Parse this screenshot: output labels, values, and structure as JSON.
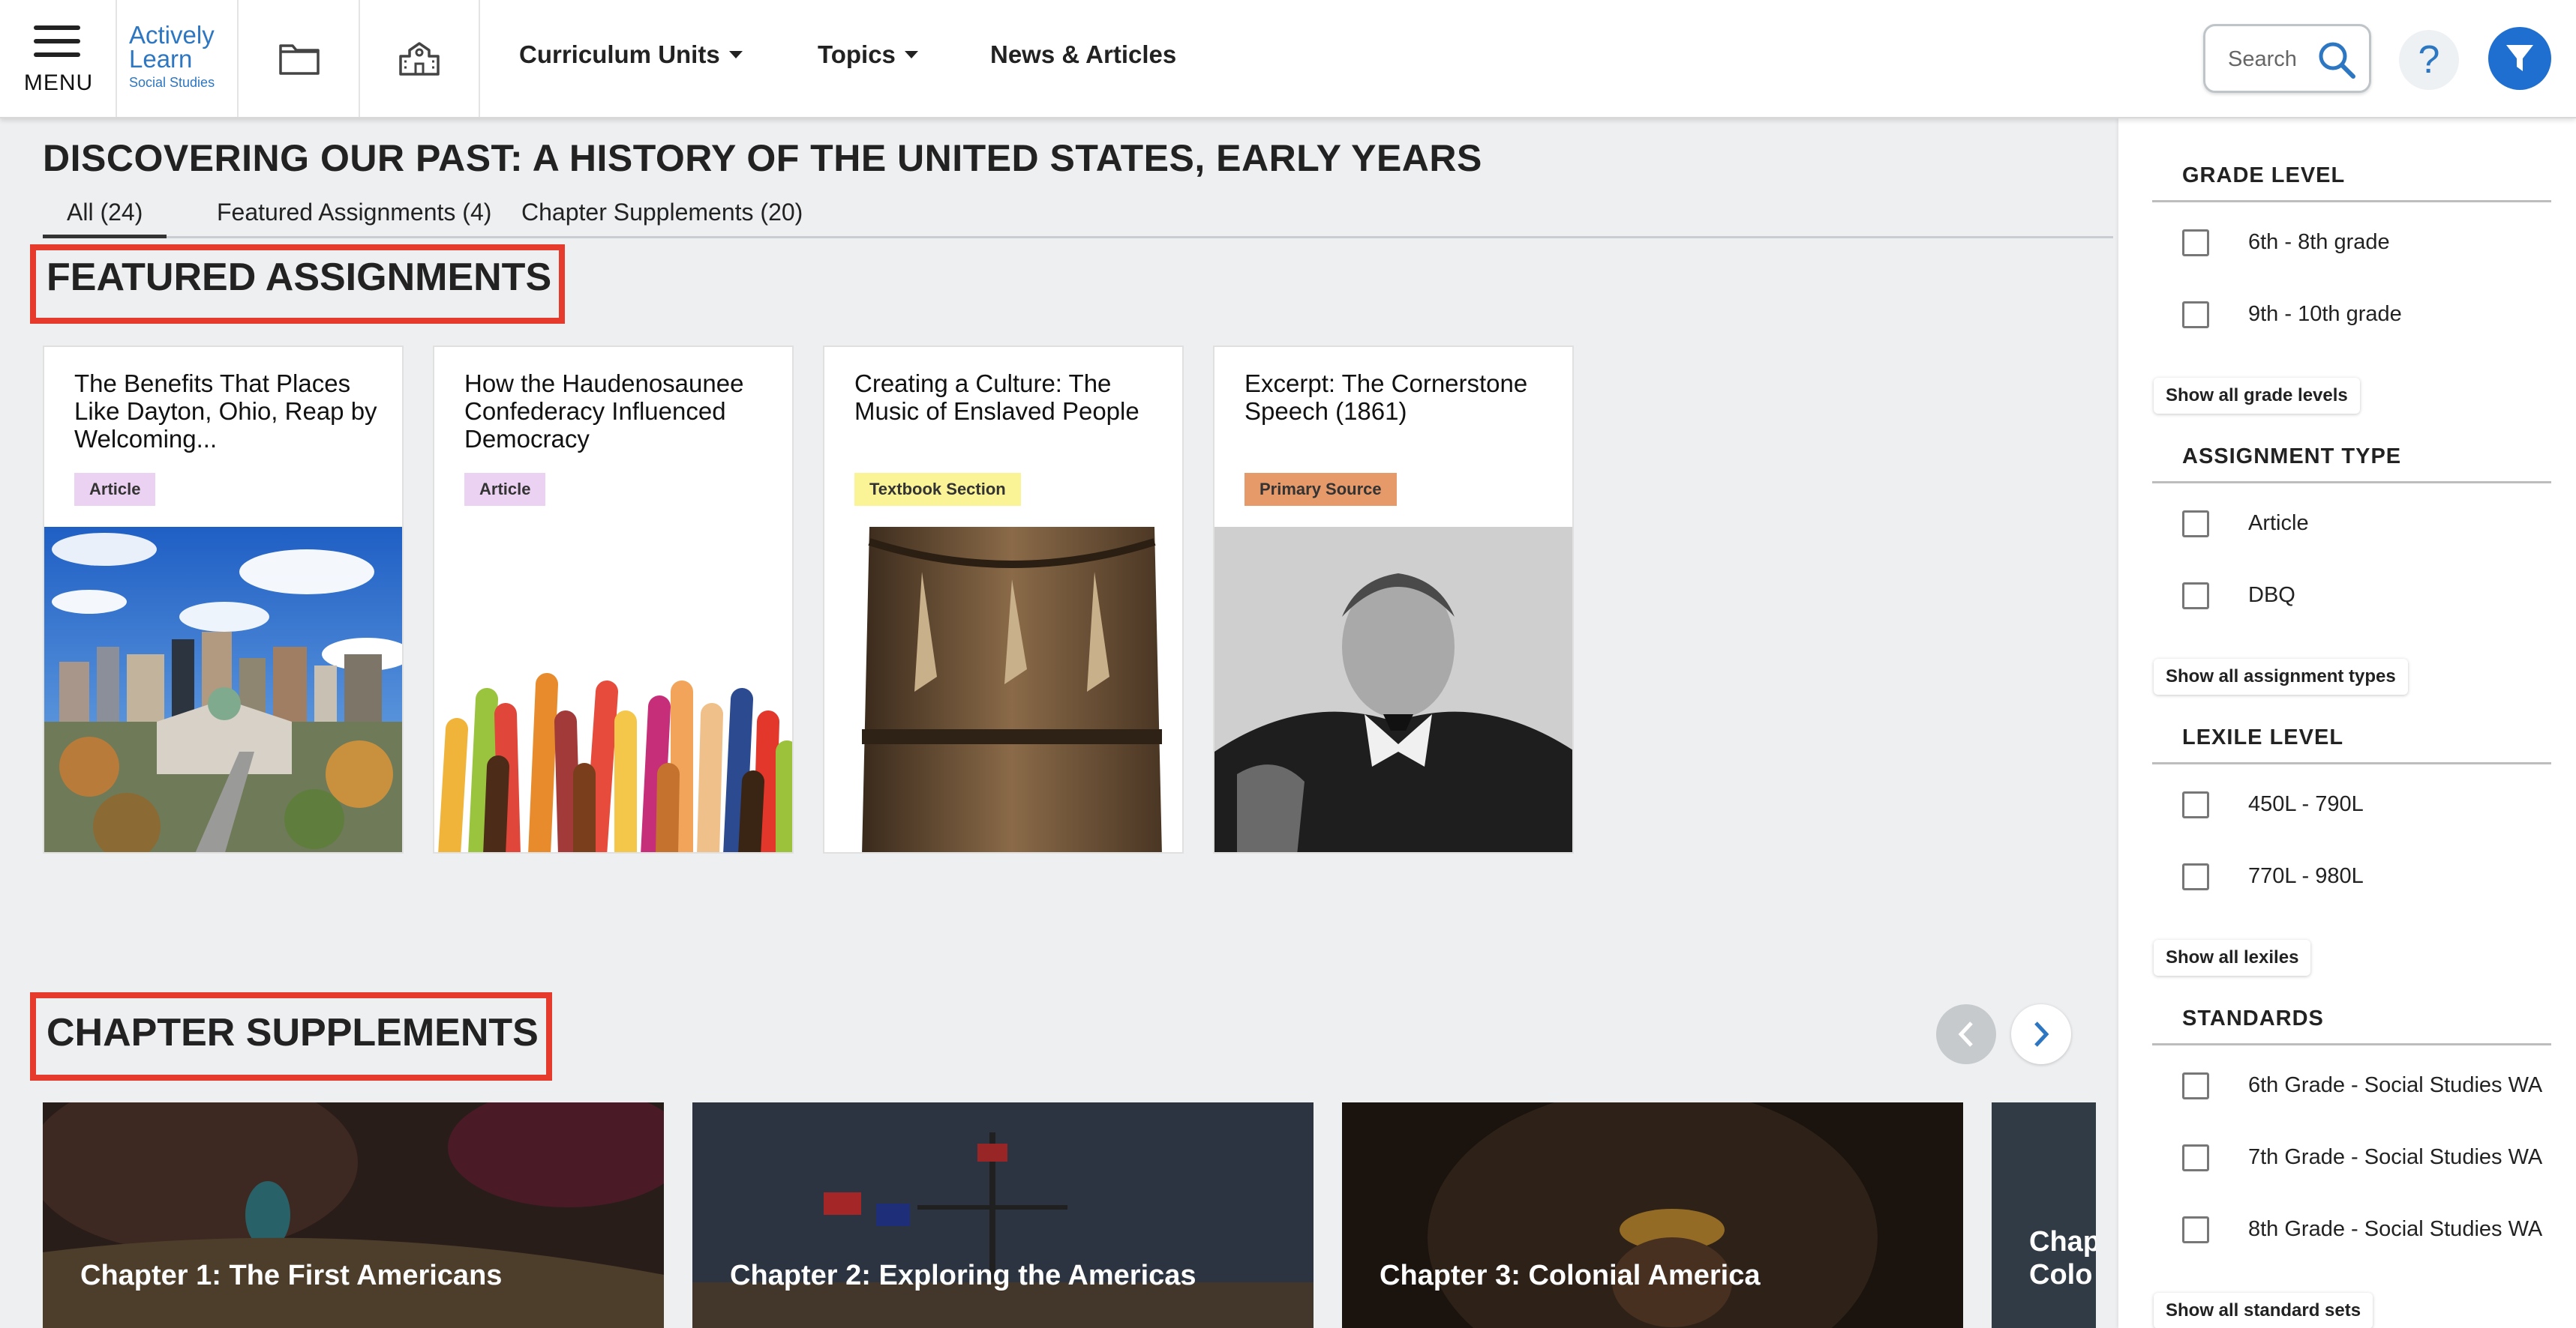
{
  "header": {
    "menu_label": "MENU",
    "logo": {
      "line1": "Actively",
      "line2": "Learn",
      "line3": "Social Studies"
    },
    "nav": [
      {
        "label": "Curriculum Units",
        "dropdown": true
      },
      {
        "label": "Topics",
        "dropdown": true
      },
      {
        "label": "News & Articles",
        "dropdown": false
      }
    ],
    "search_placeholder": "Search",
    "help_label": "?"
  },
  "main": {
    "title": "DISCOVERING OUR PAST: A HISTORY OF THE UNITED STATES, EARLY YEARS",
    "tabs": [
      {
        "label": "All (24)",
        "active": true
      },
      {
        "label": "Featured Assignments (4)",
        "active": false
      },
      {
        "label": "Chapter Supplements (20)",
        "active": false
      }
    ],
    "featured": {
      "heading": "FEATURED ASSIGNMENTS",
      "cards": [
        {
          "title": "The Benefits That Places Like Dayton, Ohio, Reap by Welcoming...",
          "badge": "Article",
          "badge_color": "#ecd2f2"
        },
        {
          "title": "How the Haudenosaunee Confederacy Influenced Democracy",
          "badge": "Article",
          "badge_color": "#ecd2f2"
        },
        {
          "title": "Creating a Culture: The Music of Enslaved People",
          "badge": "Textbook Section",
          "badge_color": "#fbf497"
        },
        {
          "title": "Excerpt: The Cornerstone Speech (1861)",
          "badge": "Primary Source",
          "badge_color": "#e69a6a"
        }
      ]
    },
    "chapters": {
      "heading": "CHAPTER SUPPLEMENTS",
      "items": [
        {
          "label": "Chapter 1: The First Americans"
        },
        {
          "label": "Chapter 2: Exploring the Americas"
        },
        {
          "label": "Chapter 3: Colonial America"
        },
        {
          "label": "Chap",
          "label2": "Colo"
        }
      ]
    }
  },
  "sidebar": {
    "sections": [
      {
        "heading": "GRADE LEVEL",
        "options": [
          "6th - 8th grade",
          "9th - 10th grade"
        ],
        "more": "Show all grade levels"
      },
      {
        "heading": "ASSIGNMENT TYPE",
        "options": [
          "Article",
          "DBQ"
        ],
        "more": "Show all assignment types"
      },
      {
        "heading": "LEXILE LEVEL",
        "options": [
          "450L - 790L",
          "770L - 980L"
        ],
        "more": "Show all lexiles"
      },
      {
        "heading": "STANDARDS",
        "options": [
          "6th Grade - Social Studies WA",
          "7th Grade - Social Studies WA",
          "8th Grade - Social Studies WA"
        ],
        "more": "Show all standard sets"
      }
    ]
  },
  "colors": {
    "brand_blue": "#2d76c2",
    "filter_blue": "#1f6fd0",
    "highlight_red": "#e53a2c"
  }
}
